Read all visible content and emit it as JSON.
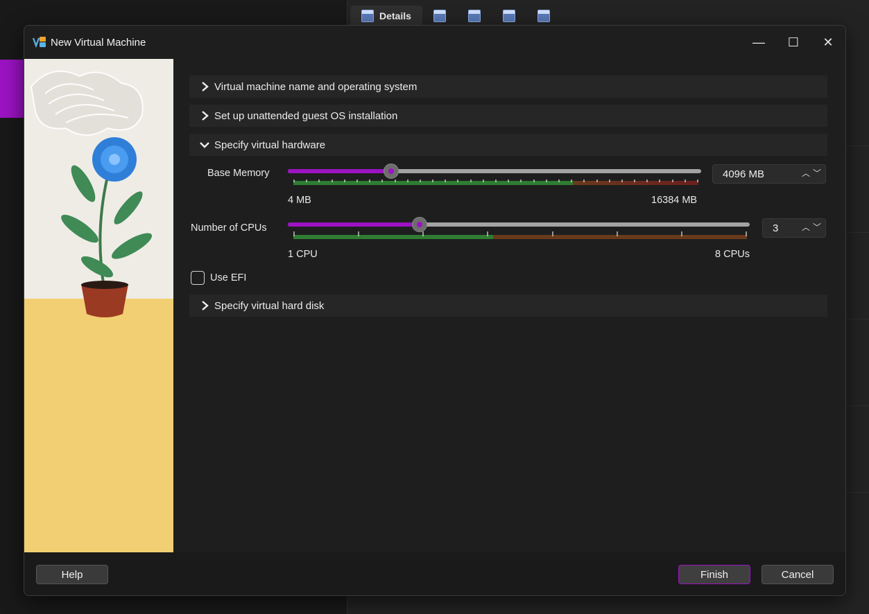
{
  "background": {
    "tabs": [
      {
        "label": "Details",
        "icon": "details-icon"
      },
      {
        "label": "",
        "icon": "snapshots-icon"
      },
      {
        "label": "",
        "icon": "logs-icon"
      },
      {
        "label": "",
        "icon": "activity-icon"
      },
      {
        "label": "",
        "icon": "preview-icon"
      }
    ],
    "accent_color": "#9b13c2"
  },
  "dialog": {
    "title": "New Virtual Machine",
    "logo_icon": "virtualbox-logo-icon",
    "window_controls": {
      "minimize": "—",
      "maximize": "☐",
      "close": "✕"
    },
    "sections": [
      {
        "label": "Virtual machine name and operating system",
        "expanded": false
      },
      {
        "label": "Set up unattended guest OS installation",
        "expanded": false
      },
      {
        "label": "Specify virtual hardware",
        "expanded": true
      },
      {
        "label": "Specify virtual hard disk",
        "expanded": false
      }
    ],
    "hardware": {
      "memory": {
        "label": "Base Memory",
        "value": "4096 MB",
        "min_label": "4 MB",
        "max_label": "16384 MB",
        "level": 0.25
      },
      "cpus": {
        "label": "Number of CPUs",
        "value": "3",
        "min_label": "1 CPU",
        "max_label": "8 CPUs",
        "level": 0.2857
      },
      "efi": {
        "label": "Use EFI",
        "checked": false
      }
    },
    "buttons": {
      "help": "Help",
      "finish": "Finish",
      "cancel": "Cancel"
    },
    "colors": {
      "accent": "#9b13c2",
      "safe": "#2e7d32",
      "warn": "#7a3b1e",
      "danger": "#6b1f1f"
    }
  }
}
